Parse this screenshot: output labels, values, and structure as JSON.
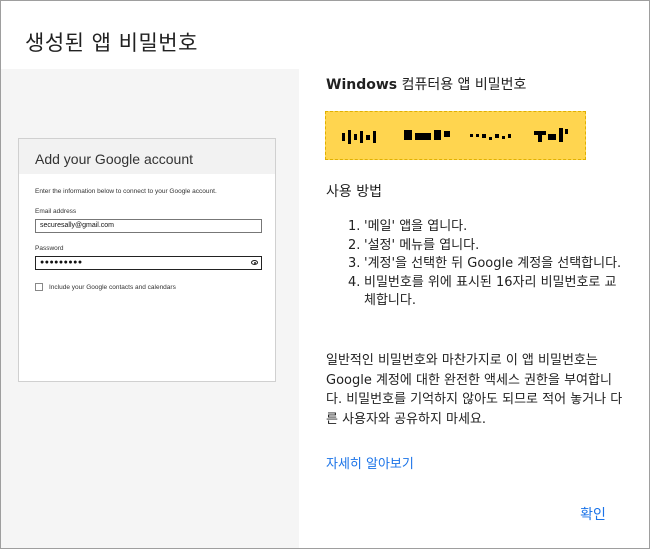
{
  "dialog": {
    "title": "생성된 앱 비밀번호",
    "ok_label": "확인"
  },
  "mock_signin": {
    "title": "Add your Google account",
    "intro": "Enter the information below to connect to your Google account.",
    "email_label": "Email address",
    "email_value": "securesally@gmail.com",
    "password_label": "Password",
    "password_value": "●●●●●●●●●",
    "include_label": "Include your Google contacts and calendars"
  },
  "info": {
    "heading_bold": "Windows",
    "heading_rest": " 컴퓨터용 앱 비밀번호",
    "usage_title": "사용 방법",
    "steps": [
      {
        "num": "1.",
        "text": "'메일' 앱을 엽니다."
      },
      {
        "num": "2.",
        "text": "'설정' 메뉴를 엽니다."
      },
      {
        "num": "3.",
        "text": "'계정'을 선택한 뒤 Google 계정을 선택합니다."
      },
      {
        "num": "4.",
        "text": "비밀번호를 위에 표시된 16자리 비밀번호로 교체합니다."
      }
    ],
    "paragraph": "일반적인 비밀번호와 마찬가지로 이 앱 비밀번호는 Google 계정에 대한 완전한 액세스 권한을 부여합니다. 비밀번호를 기억하지 않아도 되므로 적어 놓거나 다른 사용자와 공유하지 마세요.",
    "learn_more": "자세히 알아보기"
  },
  "colors": {
    "accent": "#1a73e8",
    "password_box": "#ffd54f"
  }
}
